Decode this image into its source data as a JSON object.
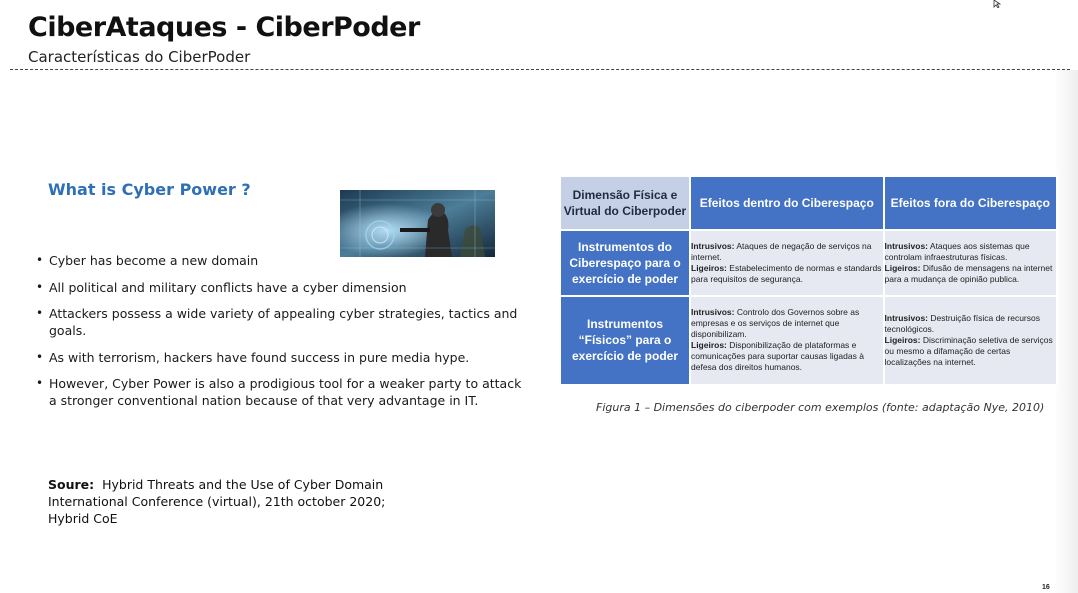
{
  "slide": {
    "title": "CiberAtaques - CiberPoder",
    "subtitle": "Características do CiberPoder",
    "page_number": "16"
  },
  "left": {
    "heading": "What is Cyber Power ?",
    "bullets": [
      "Cyber has become a new domain",
      "All political and military conflicts have a cyber dimension",
      "Attackers possess a wide variety of appealing cyber strategies, tactics and goals.",
      "As with terrorism, hackers have found success in pure media hype.",
      "However, Cyber Power is also a prodigious tool for a weaker party to attack a stronger conventional nation because of that very advantage in IT."
    ],
    "source_label": "Soure:",
    "source_text": "Hybrid Threats and the Use of Cyber Domain International Conference (virtual), 21th october 2020; Hybrid CoE"
  },
  "table": {
    "corner_header": "Dimensão Física e Virtual do Ciberpoder",
    "col_headers": [
      "Efeitos dentro do Ciberespaço",
      "Efeitos fora do Ciberespaço"
    ],
    "rows": [
      {
        "header": "Instrumentos do Ciberespaço para o exercício de poder",
        "cells": [
          {
            "intr_label": "Intrusivos:",
            "intr_text": "Ataques de negação de serviços na internet.",
            "lig_label": "Ligeiros:",
            "lig_text": "Estabelecimento de normas e standards para requisitos de segurança."
          },
          {
            "intr_label": "Intrusivos:",
            "intr_text": "Ataques aos sistemas que controlam infraestruturas físicas.",
            "lig_label": "Ligeiros:",
            "lig_text": "Difusão de mensagens na internet para a mudança de opinião publica."
          }
        ]
      },
      {
        "header": "Instrumentos “Físicos” para o exercício de poder",
        "cells": [
          {
            "intr_label": "Intrusivos:",
            "intr_text": "Controlo dos Governos sobre as empresas e os serviços de internet que disponibilizam.",
            "lig_label": "Ligeiros:",
            "lig_text": "Disponibilização de plataformas e comunicações para suportar causas ligadas à defesa dos direitos humanos."
          },
          {
            "intr_label": "Intrusivos:",
            "intr_text": "Destruição física de recursos tecnológicos.",
            "lig_label": "Ligeiros:",
            "lig_text": "Discriminação seletiva de serviços ou mesmo a difamação de certas localizações na internet."
          }
        ]
      }
    ],
    "caption": "Figura 1 – Dimensões do ciberpoder com exemplos (fonte: adaptação Nye, 2010)"
  },
  "colors": {
    "heading_blue": "#2e6fb5",
    "table_header_blue": "#4472c4",
    "table_corner": "#c5cfe6",
    "table_cell": "#e6e9f2"
  },
  "icons": [
    "cursor-icon",
    "cyber-soldier-image",
    "bullet-icon"
  ]
}
